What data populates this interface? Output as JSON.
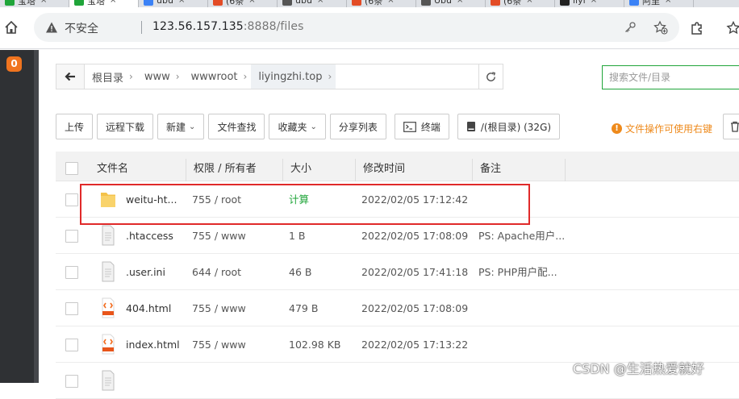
{
  "browser": {
    "tabs": [
      {
        "label": "宝塔",
        "color": "#20a53a"
      },
      {
        "label": "宝塔",
        "color": "#20a53a"
      },
      {
        "label": "ubu",
        "color": "#3b82f6"
      },
      {
        "label": "(6条",
        "color": "#e34c26"
      },
      {
        "label": "ubu",
        "color": "#555555"
      },
      {
        "label": "(6条",
        "color": "#e34c26"
      },
      {
        "label": "Ubu",
        "color": "#555555"
      },
      {
        "label": "(6条",
        "color": "#e34c26"
      },
      {
        "label": "liyi",
        "color": "#222222"
      },
      {
        "label": "阿里",
        "color": "#3b82f6"
      }
    ],
    "insecure_label": "不安全",
    "url_host": "123.56.157.135",
    "url_rest": ":8888/files"
  },
  "sidebar": {
    "badge": "0"
  },
  "path": {
    "crumbs": [
      "根目录",
      "www",
      "wwwroot",
      "liyingzhi.top"
    ]
  },
  "search": {
    "placeholder": "搜索文件/目录"
  },
  "toolbar": {
    "upload": "上传",
    "remote_download": "远程下载",
    "new": "新建",
    "find": "文件查找",
    "favorites": "收藏夹",
    "share_list": "分享列表",
    "terminal": "终端",
    "disk": "/(根目录) (32G)",
    "tip": "文件操作可使用右键"
  },
  "table": {
    "headers": {
      "name": "文件名",
      "perm": "权限 / 所有者",
      "size": "大小",
      "mtime": "修改时间",
      "note": "备注"
    },
    "rows": [
      {
        "name": "weitu-ht...",
        "type": "folder",
        "perm": "755 / root",
        "size": "计算",
        "mtime": "2022/02/05 17:12:42",
        "note": ""
      },
      {
        "name": ".htaccess",
        "type": "file",
        "perm": "755 / www",
        "size": "1 B",
        "mtime": "2022/02/05 17:08:09",
        "note": "PS: Apache用户..."
      },
      {
        "name": ".user.ini",
        "type": "file",
        "perm": "644 / root",
        "size": "46 B",
        "mtime": "2022/02/05 17:41:18",
        "note": "PS: PHP用户配..."
      },
      {
        "name": "404.html",
        "type": "html",
        "perm": "755 / www",
        "size": "479 B",
        "mtime": "2022/02/05 17:08:09",
        "note": ""
      },
      {
        "name": "index.html",
        "type": "html",
        "perm": "755 / www",
        "size": "102.98 KB",
        "mtime": "2022/02/05 17:13:22",
        "note": ""
      },
      {
        "name": "",
        "type": "file",
        "perm": "",
        "size": "",
        "mtime": "",
        "note": ""
      }
    ]
  },
  "watermark": "CSDN @生活热爱就好"
}
